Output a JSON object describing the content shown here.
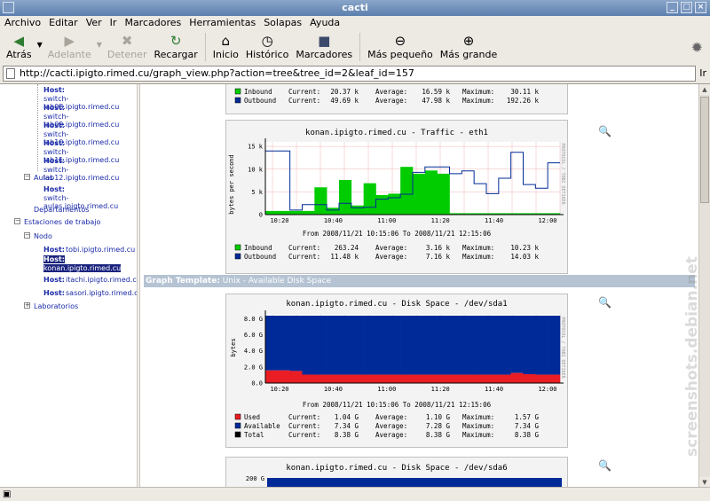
{
  "window": {
    "title": "cacti"
  },
  "menu": [
    "Archivo",
    "Editar",
    "Ver",
    "Ir",
    "Marcadores",
    "Herramientas",
    "Solapas",
    "Ayuda"
  ],
  "toolbar": {
    "back": "Atrás",
    "forward": "Adelante",
    "stop": "Detener",
    "reload": "Recargar",
    "home": "Inicio",
    "history": "Histórico",
    "bookmarks": "Marcadores",
    "zoom_out": "Más pequeño",
    "zoom_in": "Más grande"
  },
  "urlbar": {
    "url": "http://cacti.ipigto.rimed.cu/graph_view.php?action=tree&tree_id=2&leaf_id=157",
    "go": "Ir"
  },
  "tree": {
    "host_label": "Host:",
    "top_hosts": [
      "switch-lab08.ipigto.rimed.cu",
      "switch-lab09.ipigto.rimed.cu",
      "switch-lab10.ipigto.rimed.cu",
      "switch-lab11.ipigto.rimed.cu",
      "switch-lab12.ipigto.rimed.cu"
    ],
    "aulas": "Aulas",
    "aulas_host": "switch-aulas.ipigto.rimed.cu",
    "departamentos": "Departamentos",
    "estaciones": "Estaciones de trabajo",
    "nodo": "Nodo",
    "nodo_hosts": [
      "tobi.ipigto.rimed.cu",
      "konan.ipigto.rimed.cu",
      "itachi.ipigto.rimed.cu",
      "sasori.ipigto.rimed.cu"
    ],
    "laboratorios": "Laboratorios"
  },
  "graph1_legend": {
    "rows": [
      {
        "name": "Inbound",
        "color": "#00cc00",
        "current": "20.37 k",
        "average": "16.59 k",
        "maximum": "30.11 k"
      },
      {
        "name": "Outbound",
        "color": "#002a97",
        "current": "49.69 k",
        "average": "47.98 k",
        "maximum": "192.26 k"
      }
    ]
  },
  "graph2": {
    "title": "konan.ipigto.rimed.cu - Traffic - eth1",
    "ylabel": "bytes per second",
    "side": "PROTOCOL / TOBI OETIKER",
    "range": "From 2008/11/21 10:15:06 To 2008/11/21 12:15:06",
    "rows": [
      {
        "name": "Inbound",
        "color": "#00cc00",
        "current": "263.24",
        "average": "3.16 k",
        "maximum": "10.23 k"
      },
      {
        "name": "Outbound",
        "color": "#002a97",
        "current": "11.48 k",
        "average": "7.16 k",
        "maximum": "14.03 k"
      }
    ]
  },
  "graph_template": {
    "label": "Graph Template:",
    "value": "Unix - Available Disk Space"
  },
  "graph3": {
    "title": "konan.ipigto.rimed.cu - Disk Space - /dev/sda1",
    "ylabel": "bytes",
    "side": "PROTOCOL / TOBI OETIKER",
    "range": "From 2008/11/21 10:15:06 To 2008/11/21 12:15:06",
    "rows": [
      {
        "name": "Used",
        "color": "#ea1c24",
        "current": "1.04 G",
        "average": "1.10 G",
        "maximum": "1.57 G"
      },
      {
        "name": "Available",
        "color": "#002a97",
        "current": "7.34 G",
        "average": "7.28 G",
        "maximum": "7.34 G"
      },
      {
        "name": "Total",
        "color": "#000000",
        "current": "8.38 G",
        "average": "8.38 G",
        "maximum": "8.38 G"
      }
    ]
  },
  "graph4": {
    "title": "konan.ipigto.rimed.cu - Disk Space - /dev/sda6",
    "y_top": "200 G"
  },
  "legend_labels": {
    "current": "Current:",
    "average": "Average:",
    "maximum": "Maximum:"
  },
  "watermark": "screenshots.debian.net",
  "chart_data": [
    {
      "type": "area",
      "title": "konan.ipigto.rimed.cu - Traffic - eth1",
      "ylabel": "bytes per second",
      "x": [
        "10:20",
        "10:40",
        "11:00",
        "11:20",
        "11:40",
        "12:00"
      ],
      "yticks": [
        "0",
        "5 k",
        "10 k",
        "15 k"
      ],
      "ylim": [
        0,
        16000
      ],
      "series": [
        {
          "name": "Inbound",
          "color": "#00cc00",
          "values": [
            800,
            800,
            800,
            800,
            6000,
            1500,
            7600,
            2000,
            6900,
            4300,
            4600,
            10500,
            9000,
            9700,
            9000,
            300,
            300,
            300,
            300,
            300,
            300,
            300,
            300,
            300
          ]
        },
        {
          "name": "Outbound",
          "color": "#002a97",
          "values": [
            14000,
            14000,
            1000,
            2200,
            2200,
            1000,
            2500,
            1500,
            1600,
            3400,
            3700,
            4500,
            9300,
            10500,
            10500,
            9000,
            9600,
            6800,
            4600,
            8000,
            13700,
            6600,
            5800,
            11400
          ]
        }
      ]
    },
    {
      "type": "area",
      "title": "konan.ipigto.rimed.cu - Disk Space - /dev/sda1",
      "ylabel": "bytes",
      "x": [
        "10:20",
        "10:40",
        "11:00",
        "11:20",
        "11:40",
        "12:00"
      ],
      "yticks": [
        "0.0",
        "2.0 G",
        "4.0 G",
        "6.0 G",
        "8.0 G"
      ],
      "ylim": [
        0,
        8.6
      ],
      "series": [
        {
          "name": "Used",
          "color": "#ea1c24",
          "values": [
            1.57,
            1.57,
            1.5,
            1.05,
            1.04,
            1.04,
            1.04,
            1.04,
            1.04,
            1.04,
            1.04,
            1.04,
            1.04,
            1.04,
            1.04,
            1.04,
            1.04,
            1.04,
            1.04,
            1.04,
            1.25,
            1.1,
            1.04,
            1.04
          ]
        },
        {
          "name": "Available",
          "color": "#002a97",
          "values": [
            6.81,
            6.81,
            6.88,
            7.33,
            7.34,
            7.34,
            7.34,
            7.34,
            7.34,
            7.34,
            7.34,
            7.34,
            7.34,
            7.34,
            7.34,
            7.34,
            7.34,
            7.34,
            7.34,
            7.34,
            7.13,
            7.28,
            7.34,
            7.34
          ]
        }
      ]
    }
  ]
}
